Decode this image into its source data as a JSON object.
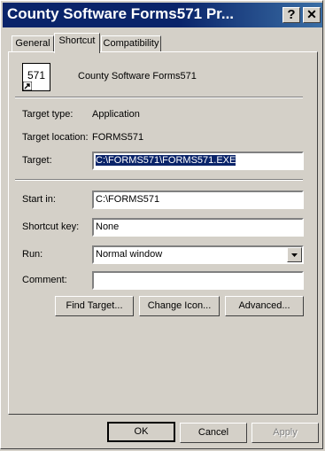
{
  "window": {
    "title": "County Software Forms571 Pr..."
  },
  "titlebar_buttons": {
    "help": "?",
    "close": "✕"
  },
  "tabs": [
    {
      "label": "General"
    },
    {
      "label": "Shortcut"
    },
    {
      "label": "Compatibility"
    }
  ],
  "app": {
    "icon_text": "571",
    "name": "County Software Forms571"
  },
  "fields": {
    "target_type": {
      "label": "Target type:",
      "value": "Application"
    },
    "target_location": {
      "label": "Target location:",
      "value": "FORMS571"
    },
    "target": {
      "label": "Target:",
      "value": "C:\\FORMS571\\FORMS571.EXE"
    },
    "start_in": {
      "label": "Start in:",
      "value": "C:\\FORMS571"
    },
    "shortcut_key": {
      "label": "Shortcut key:",
      "value": "None"
    },
    "run": {
      "label": "Run:",
      "value": "Normal window"
    },
    "comment": {
      "label": "Comment:",
      "value": ""
    }
  },
  "buttons": {
    "find_target": "Find Target...",
    "change_icon": "Change Icon...",
    "advanced": "Advanced...",
    "ok": "OK",
    "cancel": "Cancel",
    "apply": "Apply"
  }
}
